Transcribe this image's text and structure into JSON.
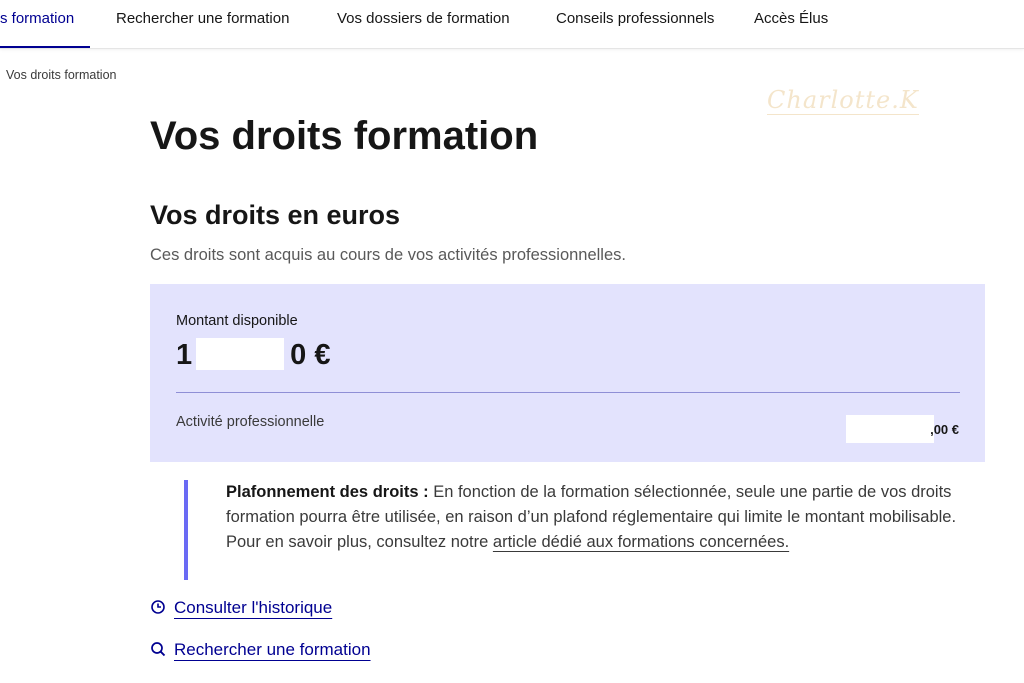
{
  "nav": {
    "items": [
      {
        "label": "s formation",
        "active": true
      },
      {
        "label": "Rechercher une formation"
      },
      {
        "label": "Vos dossiers de formation"
      },
      {
        "label": "Conseils professionnels"
      },
      {
        "label": "Accès Élus"
      }
    ]
  },
  "breadcrumb": {
    "current": "Vos droits formation"
  },
  "watermark": {
    "text": "Charlotte.K"
  },
  "page": {
    "title": "Vos droits formation"
  },
  "rights": {
    "title": "Vos droits en euros",
    "description": "Ces droits sont acquis au cours de vos activités professionnelles.",
    "card": {
      "available_label": "Montant disponible",
      "amount_prefix": "1",
      "amount_suffix": "0 €",
      "row_label": "Activité professionnelle",
      "row_value_suffix": ",00 €"
    }
  },
  "notice": {
    "bold": "Plafonnement des droits :",
    "text": " En fonction de la formation sélectionnée, seule une partie de vos droits formation pourra être utilisée, en raison d’un plafond réglementaire qui limite le montant mobilisable.",
    "more_text": "Pour en savoir plus, consultez notre ",
    "link": "article dédié aux formations concernées."
  },
  "links": {
    "history": "Consulter l'historique",
    "search": "Rechercher une formation"
  },
  "icons": {
    "history": "clock-icon",
    "search": "search-icon"
  },
  "colors": {
    "accent": "#000091",
    "card_bg": "#e3e3fd",
    "notice_border": "#6a6af4"
  }
}
